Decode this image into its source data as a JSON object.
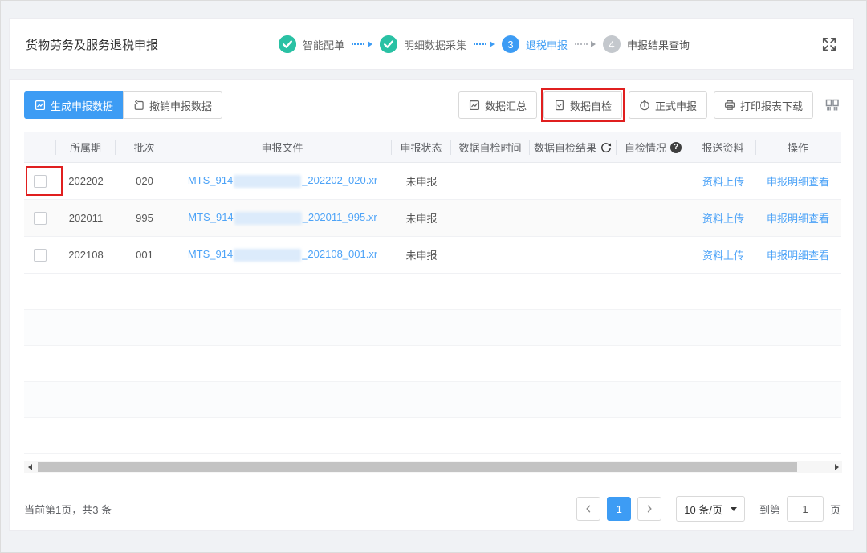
{
  "page": {
    "title": "货物劳务及服务退税申报"
  },
  "stepper": {
    "steps": [
      {
        "label": "智能配单",
        "status": "done"
      },
      {
        "label": "明细数据采集",
        "status": "done"
      },
      {
        "label": "退税申报",
        "status": "current",
        "number": "3"
      },
      {
        "label": "申报结果查询",
        "status": "pending",
        "number": "4"
      }
    ]
  },
  "toolbar": {
    "generate_label": "生成申报数据",
    "revoke_label": "撤销申报数据",
    "summary_label": "数据汇总",
    "self_check_label": "数据自检",
    "formal_label": "正式申报",
    "print_label": "打印报表下载"
  },
  "table": {
    "columns": [
      "所属期",
      "批次",
      "申报文件",
      "申报状态",
      "数据自检时间",
      "数据自检结果",
      "自检情况",
      "报送资料",
      "操作"
    ],
    "rows": [
      {
        "period": "202202",
        "batch": "020",
        "file_prefix": "MTS_914",
        "file_suffix": "_202202_020.xr",
        "status": "未申报",
        "check_time": "",
        "check_result": "",
        "self_check": "",
        "upload_label": "资料上传",
        "detail_label": "申报明细查看"
      },
      {
        "period": "202011",
        "batch": "995",
        "file_prefix": "MTS_914",
        "file_suffix": "_202011_995.xr",
        "status": "未申报",
        "check_time": "",
        "check_result": "",
        "self_check": "",
        "upload_label": "资料上传",
        "detail_label": "申报明细查看"
      },
      {
        "period": "202108",
        "batch": "001",
        "file_prefix": "MTS_914",
        "file_suffix": "_202108_001.xr",
        "status": "未申报",
        "check_time": "",
        "check_result": "",
        "self_check": "",
        "upload_label": "资料上传",
        "detail_label": "申报明细查看"
      }
    ]
  },
  "pagination": {
    "summary": "当前第1页，共3 条",
    "current_page": "1",
    "page_size": "10 条/页",
    "goto_prefix": "到第",
    "goto_value": "1",
    "goto_suffix": "页"
  },
  "colors": {
    "primary_blue": "#3d9cf4",
    "link_blue": "#4da3f7",
    "success_teal": "#2ac1a4",
    "pending_gray": "#c4c8cd",
    "annotation_red": "#e01f1f"
  }
}
